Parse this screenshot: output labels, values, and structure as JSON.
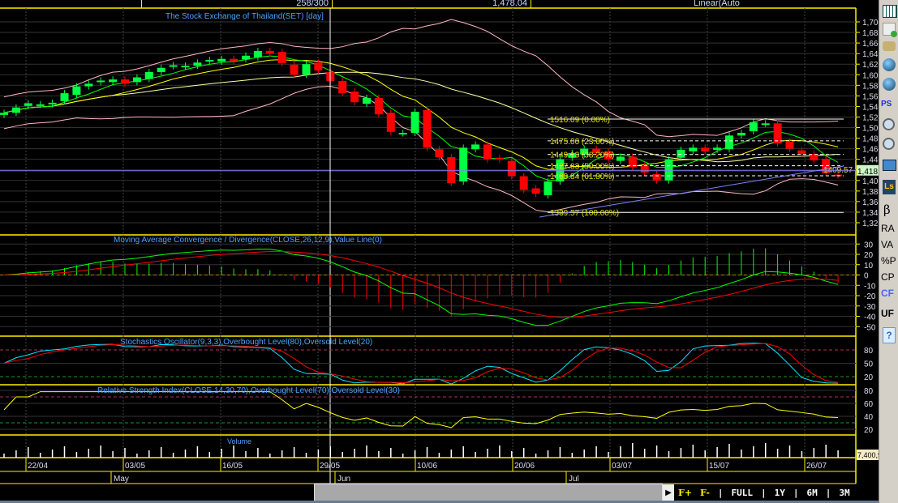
{
  "header": {
    "count": "258/300",
    "last_price": "1,478.04",
    "scale_mode": "Linear(Auto"
  },
  "price_panel": {
    "title": "The Stock Exchange of Thailand(SET) [day]",
    "y_ticks": [
      "1,700",
      "1,680",
      "1,660",
      "1,640",
      "1,620",
      "1,600",
      "1,580",
      "1,560",
      "1,540",
      "1,520",
      "1,500",
      "1,480",
      "1,460",
      "1,440",
      "1,420",
      "1,400",
      "1,380",
      "1,360",
      "1,340",
      "1,320"
    ],
    "y_range": [
      1320,
      1700
    ],
    "crosshair_price_label": "1,418.4",
    "crosshair_price": 1418.4,
    "last_close_label": "1409.57",
    "fib_levels": [
      {
        "label": "1516.09 (0.00%)",
        "price": 1516.09
      },
      {
        "label": "1475.00 (23.60%)",
        "price": 1475.0
      },
      {
        "label": "1449.13 (38.20%)",
        "price": 1449.13
      },
      {
        "label": "1427.83 (50.00%)",
        "price": 1427.83
      },
      {
        "label": "1408.84 (61.80%)",
        "price": 1408.84
      },
      {
        "label": "1339.57 (100.00%)",
        "price": 1339.57
      }
    ],
    "closes": [
      1528,
      1538,
      1546,
      1544,
      1547,
      1565,
      1578,
      1583,
      1589,
      1591,
      1583,
      1595,
      1605,
      1613,
      1618,
      1617,
      1623,
      1628,
      1630,
      1626,
      1636,
      1645,
      1640,
      1622,
      1600,
      1620,
      1608,
      1588,
      1565,
      1548,
      1556,
      1525,
      1492,
      1490,
      1530,
      1462,
      1444,
      1395,
      1462,
      1468,
      1440,
      1440,
      1408,
      1382,
      1375,
      1398,
      1440,
      1452,
      1460,
      1452,
      1440,
      1445,
      1425,
      1415,
      1400,
      1440,
      1458,
      1462,
      1455,
      1462,
      1485,
      1490,
      1510,
      1508,
      1470,
      1460,
      1450,
      1438,
      1414,
      1409.57
    ],
    "colors": {
      "up": "#00ff40",
      "down": "#ff0000",
      "band": "#ffb6c1",
      "ma_short": "#00ff00",
      "ma_mid": "#ffff00",
      "ma_long": "#ffffa0",
      "fib": "#ffffff",
      "trend": "#8080ff"
    }
  },
  "macd_panel": {
    "title": "Moving Average Convergence / Divergence(CLOSE,26,12,9),Value Line(0)",
    "y_ticks": [
      "30",
      "20",
      "10",
      "0",
      "-10",
      "-20",
      "-30",
      "-40",
      "-50"
    ],
    "y_range": [
      -50,
      30
    ]
  },
  "stoch_panel": {
    "title": "Stochastics Oscillator(9,3,3),Overbought Level(80),Oversold Level(20)",
    "y_ticks": [
      "80",
      "50",
      "20"
    ]
  },
  "rsi_panel": {
    "title": "Relative Strength Index(CLOSE,14,30,70),Overbought Level(70),Oversold Level(30)",
    "y_ticks": [
      "80",
      "60",
      "40",
      "20"
    ]
  },
  "volume_panel": {
    "title": "Volume",
    "value_label": "7,400,9"
  },
  "date_axis": [
    "22/04",
    "03/05",
    "16/05",
    "29/05",
    "10/06",
    "20/06",
    "03/07",
    "15/07",
    "26/07"
  ],
  "month_axis": [
    "May",
    "Jun",
    "Jul"
  ],
  "periods": {
    "zoom_in": "F+",
    "zoom_out": "F-",
    "full": "FULL",
    "y1": "1Y",
    "m6": "6M",
    "m3": "3M"
  },
  "toolbar": {
    "ls": "Ls",
    "beta": "β",
    "ra": "RA",
    "va": "VA",
    "pp": "%P",
    "cp": "CP",
    "cf": "CF",
    "uf": "UF",
    "ps": "PS",
    "help": "?"
  }
}
